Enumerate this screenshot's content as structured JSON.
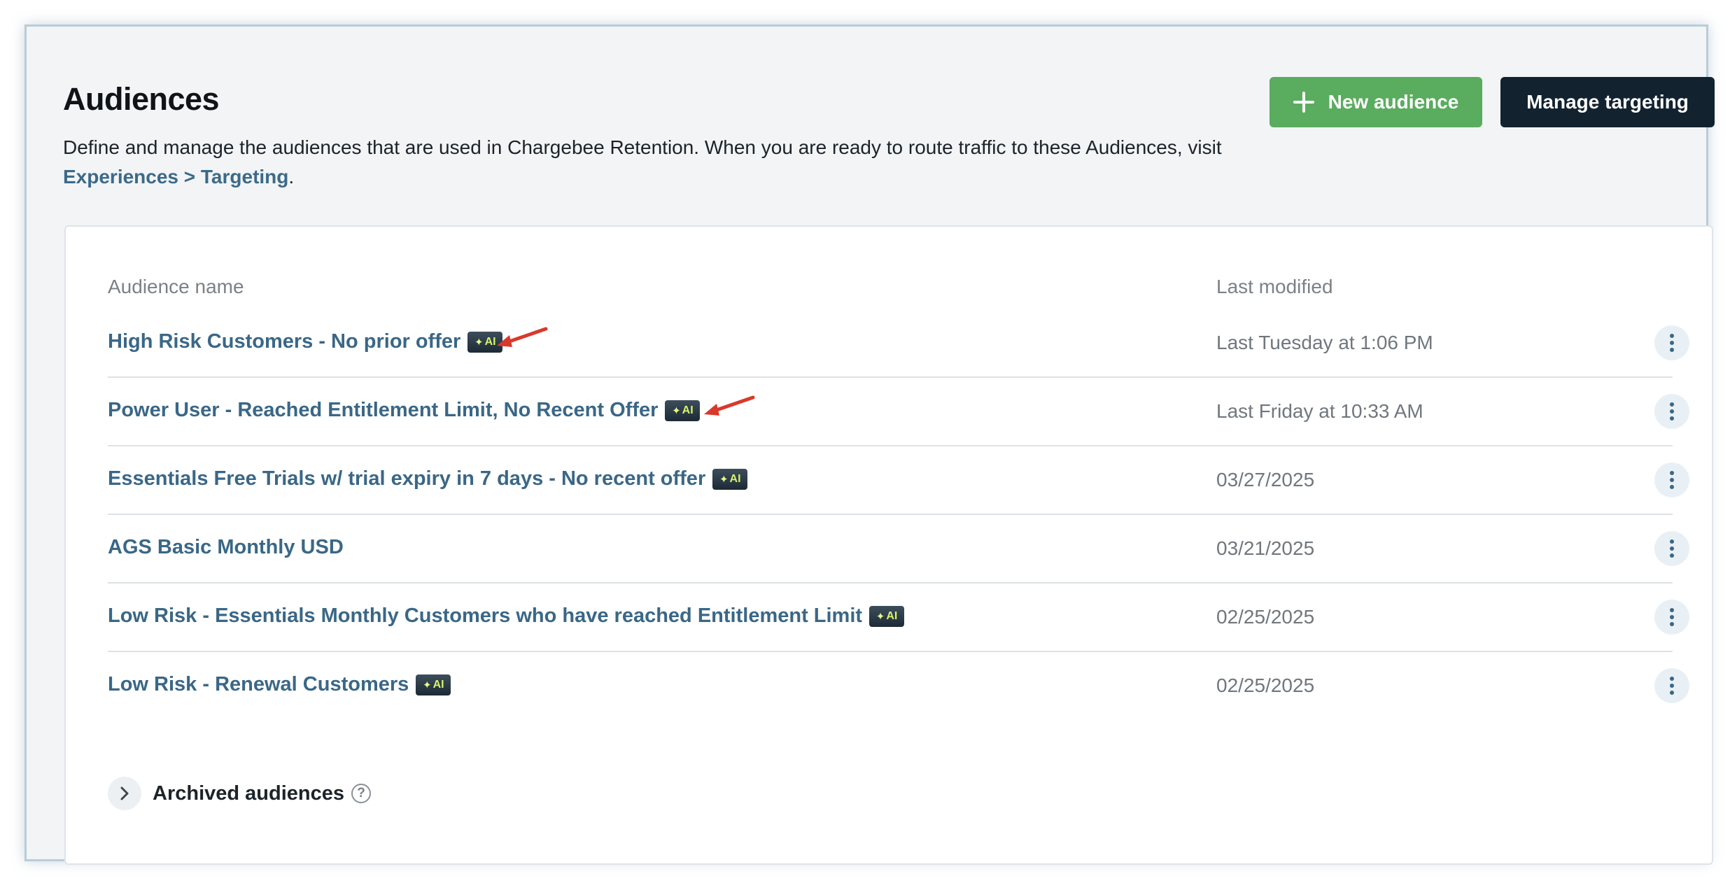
{
  "page": {
    "title": "Audiences",
    "description_text": "Define and manage the audiences that are used in Chargebee Retention. When you are ready to route traffic to these Audiences, visit ",
    "description_link": "Experiences > Targeting",
    "description_end": "."
  },
  "actions": {
    "new_audience_label": "New audience",
    "manage_targeting_label": "Manage targeting"
  },
  "colors": {
    "new_button": "#5aac5e",
    "manage_button": "#12222f",
    "link": "#3a6787",
    "annotation_arrow": "#d9392c"
  },
  "table": {
    "headers": {
      "name": "Audience name",
      "modified": "Last modified"
    },
    "rows": [
      {
        "name": "High Risk Customers - No prior offer",
        "ai": true,
        "modified": "Last Tuesday at 1:06 PM"
      },
      {
        "name": "Power User - Reached Entitlement Limit, No Recent Offer",
        "ai": true,
        "modified": "Last Friday at 10:33 AM"
      },
      {
        "name": "Essentials Free Trials w/ trial expiry in 7 days - No recent offer",
        "ai": true,
        "modified": "03/27/2025"
      },
      {
        "name": "AGS Basic Monthly USD",
        "ai": false,
        "modified": "03/21/2025"
      },
      {
        "name": "Low Risk - Essentials Monthly Customers who have reached Entitlement Limit",
        "ai": true,
        "modified": "02/25/2025"
      },
      {
        "name": "Low Risk - Renewal Customers",
        "ai": true,
        "modified": "02/25/2025"
      }
    ]
  },
  "badge": {
    "label": "AI",
    "icon": "sparkle-icon"
  },
  "archived": {
    "label": "Archived audiences",
    "help": "?"
  }
}
